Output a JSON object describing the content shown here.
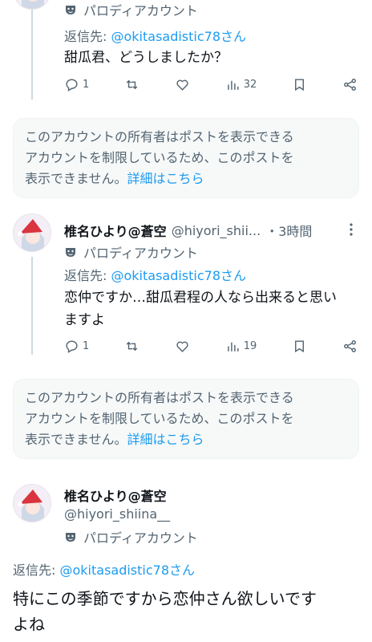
{
  "posts": [
    {
      "parody_label": "パロディアカウント",
      "reply_prefix": "返信先: ",
      "reply_handle": "@okitasadistic78さん",
      "text": "甜瓜君、どうしましたか？",
      "replies": "1",
      "views": "32"
    },
    {
      "display_name": "椎名ひより@蒼空",
      "handle": "@hiyori_shii...",
      "time": "・3時間",
      "parody_label": "パロディアカウント",
      "reply_prefix": "返信先: ",
      "reply_handle": "@okitasadistic78さん",
      "text_line1": "恋仲ですか…甜瓜君程の人なら出来ると思い",
      "text_line2": "ますよ",
      "replies": "1",
      "views": "19"
    }
  ],
  "restricted_notice": {
    "line1": "このアカウントの所有者はポストを表示できる",
    "line2": "アカウントを制限しているため、このポストを",
    "line3": "表示できません。",
    "link": "詳細はこちら"
  },
  "main_post": {
    "display_name": "椎名ひより@蒼空",
    "handle": "@hiyori_shiina__",
    "parody_label": "パロディアカウント",
    "reply_prefix": "返信先: ",
    "reply_handle": "@okitasadistic78さん",
    "text_line1": "特にこの季節ですから恋仲さん欲しいです",
    "text_line2": "よね"
  },
  "icons": [
    "avatar",
    "parody-mask-icon",
    "reply-icon",
    "retweet-icon",
    "like-icon",
    "views-icon",
    "bookmark-icon",
    "share-icon",
    "more-icon"
  ],
  "colors": {
    "link": "#1d9bf0",
    "secondary": "#536471",
    "notice_bg": "#f7f9f9"
  }
}
